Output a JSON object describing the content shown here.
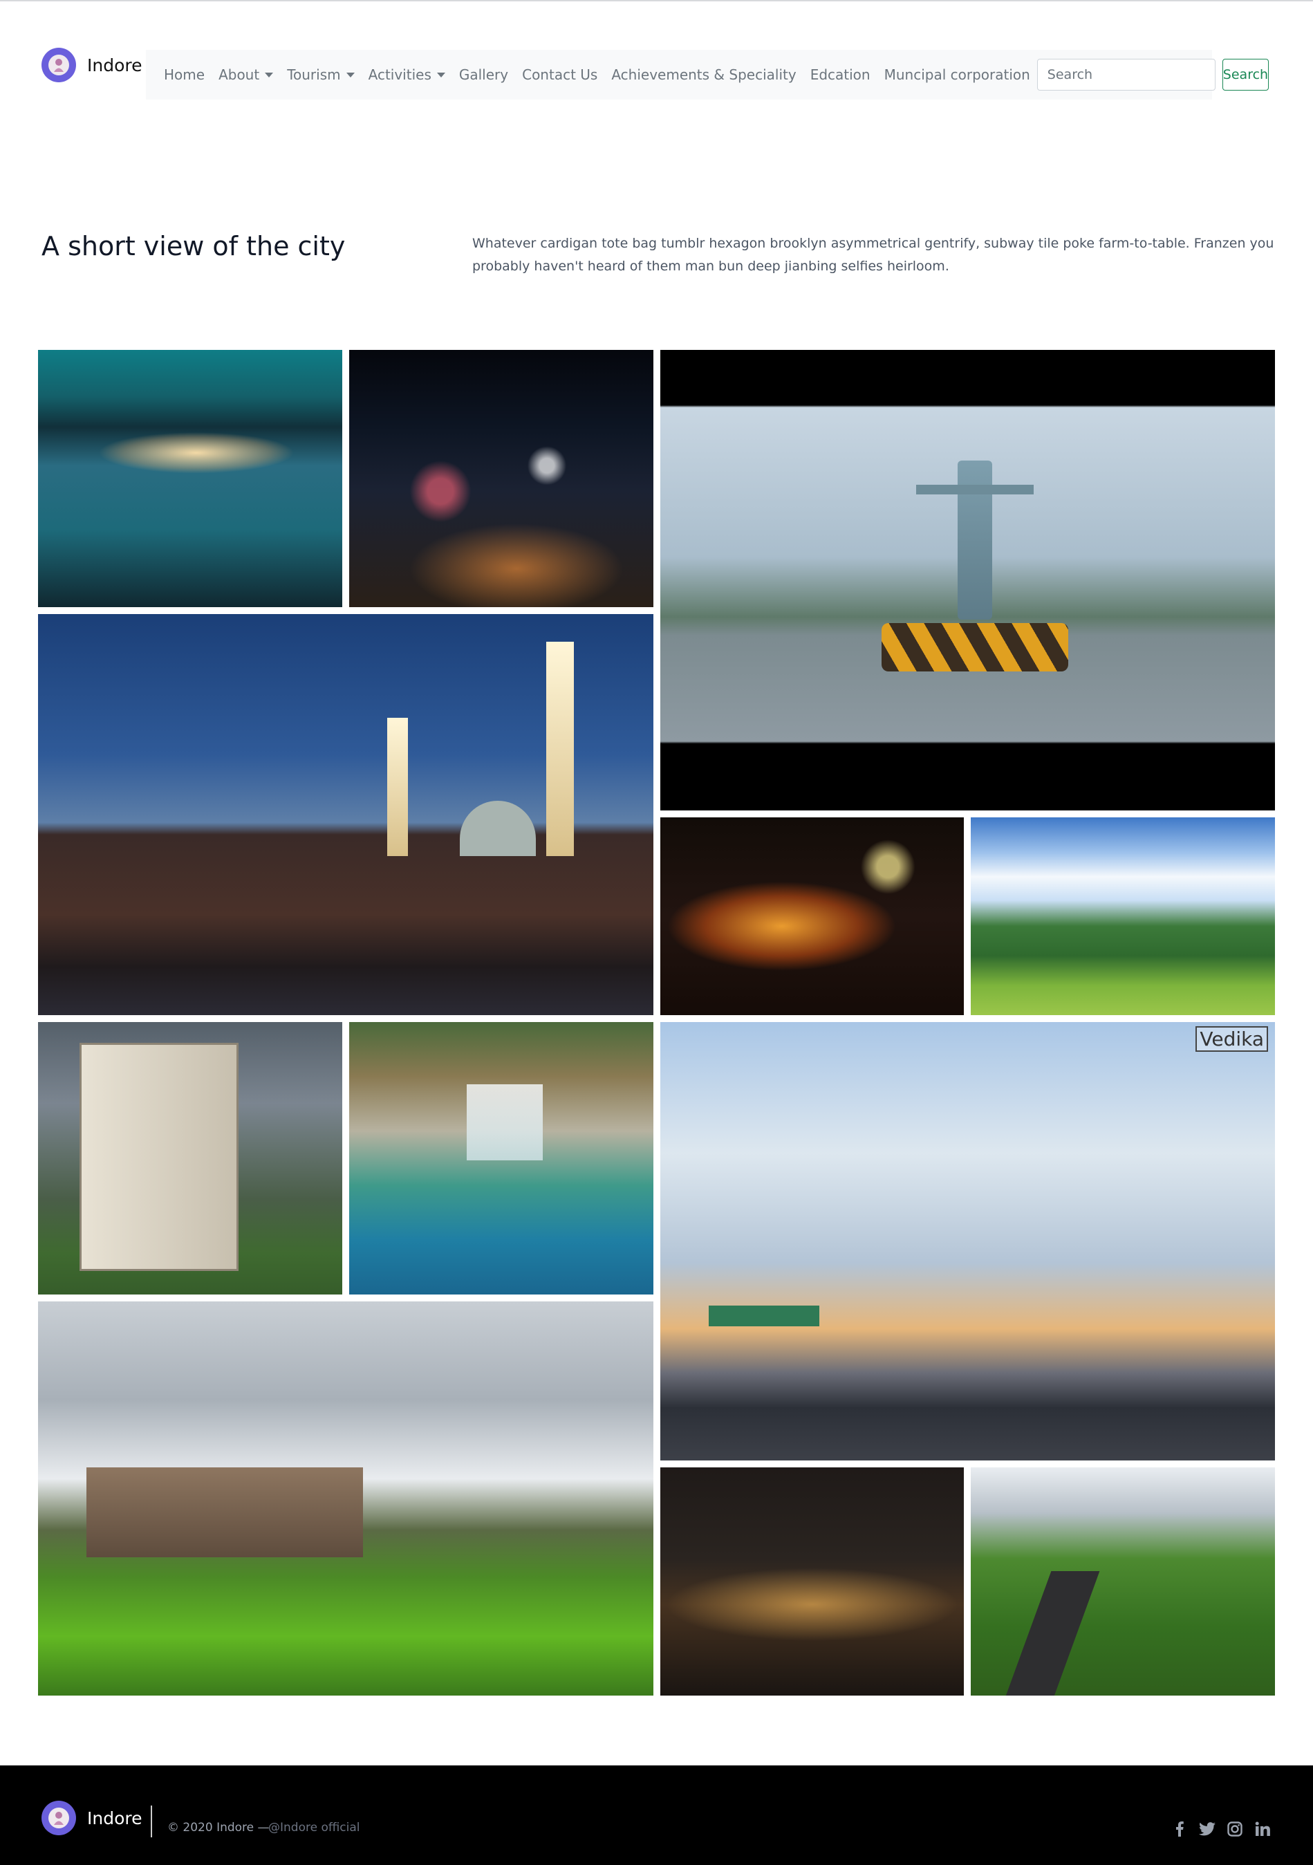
{
  "brand": {
    "name": "Indore"
  },
  "nav": {
    "items": [
      {
        "label": "Home",
        "dropdown": false
      },
      {
        "label": "About",
        "dropdown": true
      },
      {
        "label": "Tourism",
        "dropdown": true
      },
      {
        "label": "Activities",
        "dropdown": true
      },
      {
        "label": "Gallery",
        "dropdown": false
      },
      {
        "label": "Contact Us",
        "dropdown": false
      },
      {
        "label": "Achievements & Speciality",
        "dropdown": false
      },
      {
        "label": "Edcation",
        "dropdown": false
      },
      {
        "label": "Muncipal corporation",
        "dropdown": false
      }
    ],
    "search": {
      "placeholder": "Search",
      "value": "",
      "button_label": "Search"
    }
  },
  "intro": {
    "title": "A short view of the city",
    "text": "Whatever cardigan tote bag tumblr hexagon brooklyn asymmetrical gentrify, subway tile poke farm-to-table. Franzen you probably haven't heard of them man bun deep jianbing selfies heirloom."
  },
  "gallery": {
    "watermark": "Vedika"
  },
  "footer": {
    "brand": "Indore",
    "copyright": "© 2020 Indore —",
    "handle": "@Indore official",
    "socials": [
      "facebook-icon",
      "twitter-icon",
      "instagram-icon",
      "linkedin-icon"
    ]
  },
  "colors": {
    "navbar_bg": "#f8f9fa",
    "nav_text": "#6c757d",
    "search_button": "#198754",
    "logo": "#6a5fdc",
    "footer_bg": "#000000"
  }
}
